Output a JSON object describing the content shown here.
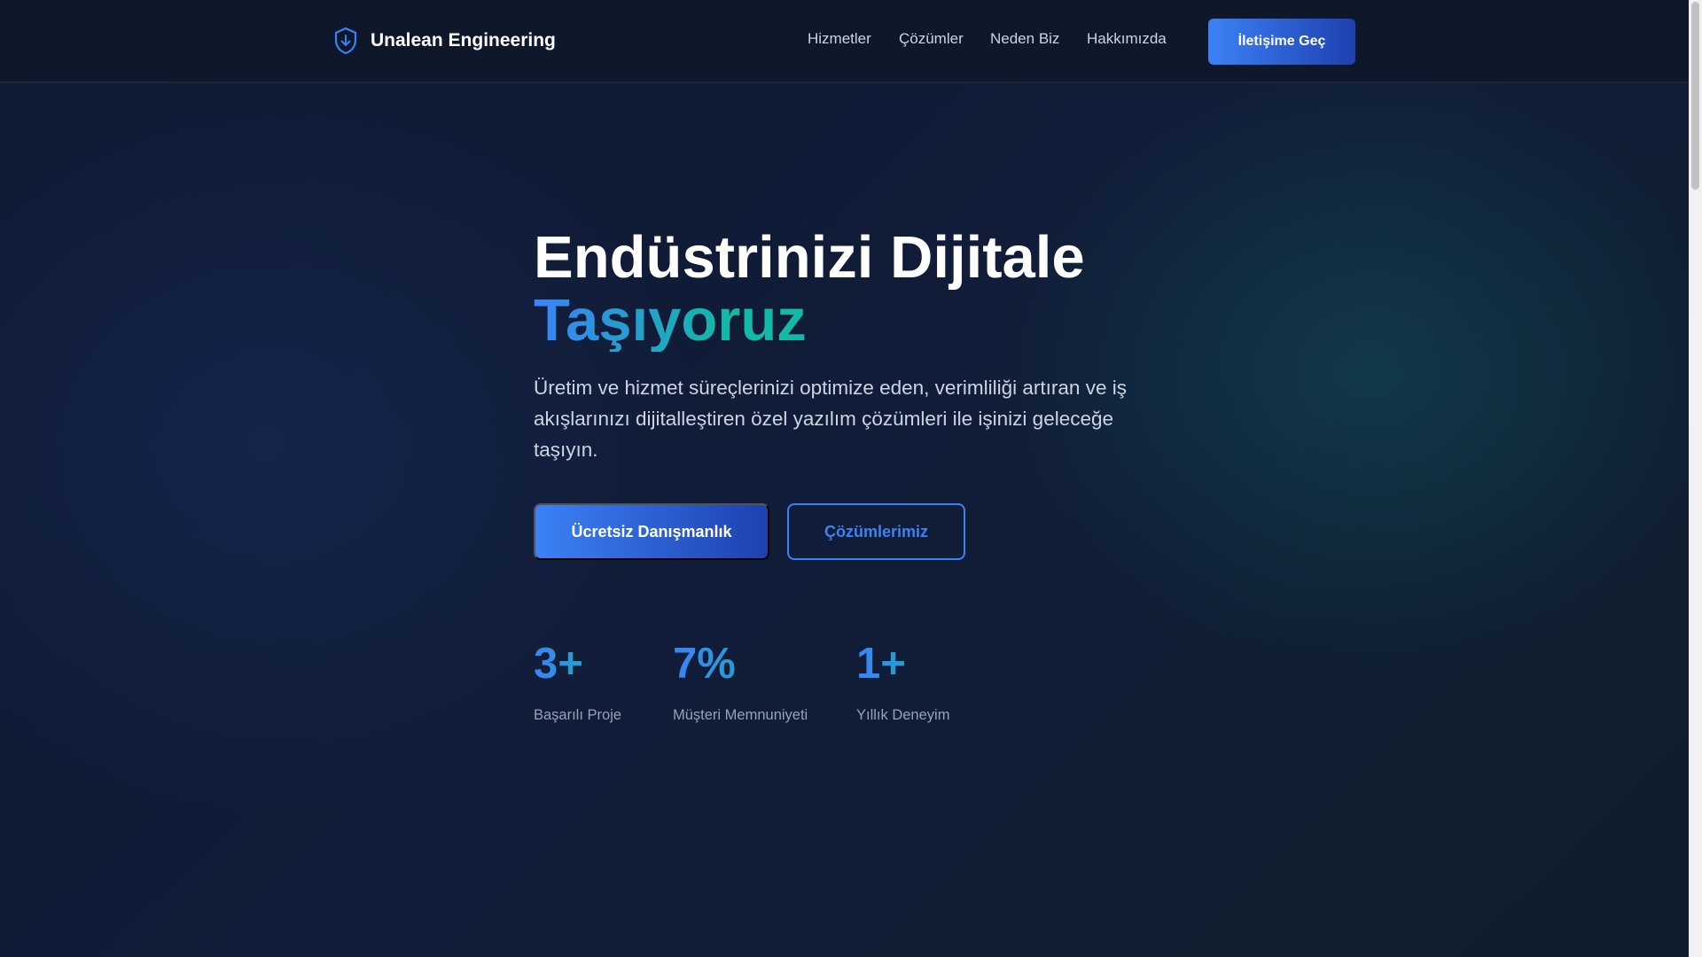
{
  "header": {
    "brand": "Unalean Engineering",
    "nav": [
      "Hizmetler",
      "Çözümler",
      "Neden Biz",
      "Hakkımızda"
    ],
    "cta": "İletişime Geç"
  },
  "hero": {
    "title_line1": "Endüstrinizi Dijitale",
    "title_line2": "Taşıyoruz",
    "description": "Üretim ve hizmet süreçlerinizi optimize eden, verimliliği artıran ve iş akışlarınızı dijitalleştiren özel yazılım çözümleri ile işinizi geleceğe taşıyın.",
    "primary_button": "Ücretsiz Danışmanlık",
    "secondary_button": "Çözümlerimiz"
  },
  "stats": [
    {
      "value": "3+",
      "label": "Başarılı Proje"
    },
    {
      "value": "7%",
      "label": "Müşteri Memnuniyeti"
    },
    {
      "value": "1+",
      "label": "Yıllık Deneyim"
    }
  ],
  "colors": {
    "accent": "#3b82f6",
    "teal": "#14b8a6",
    "bg": "#0f172a"
  }
}
